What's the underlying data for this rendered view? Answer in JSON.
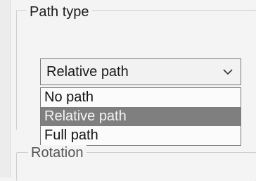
{
  "path_type_group": {
    "title": "Path type",
    "select": {
      "value": "Relative path",
      "icon": "chevron-down-icon"
    },
    "options": [
      {
        "label": "No path",
        "highlighted": false
      },
      {
        "label": "Relative path",
        "highlighted": true
      },
      {
        "label": "Full path",
        "highlighted": false
      }
    ]
  },
  "rotation_group": {
    "title": "Rotation"
  },
  "colors": {
    "highlight": "#7f7f7f",
    "background": "#f4f4f4",
    "border": "#7a7a7a"
  }
}
